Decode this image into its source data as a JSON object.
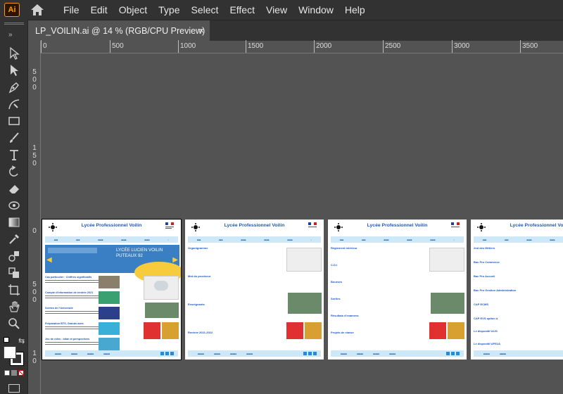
{
  "app": {
    "logo": "Ai",
    "home_icon": "home-icon"
  },
  "menu": [
    "File",
    "Edit",
    "Object",
    "Type",
    "Select",
    "Effect",
    "View",
    "Window",
    "Help"
  ],
  "document_tab": {
    "title": "LP_VOILIN.ai @ 14 % (RGB/CPU Preview)",
    "close": "×"
  },
  "ruler": {
    "top": [
      "0",
      "500",
      "1000",
      "1500",
      "2000",
      "2500",
      "3000",
      "3500"
    ],
    "left": [
      "5",
      "0",
      "0",
      "1",
      "5",
      "0",
      "0",
      "5",
      "0",
      "0",
      "1",
      "0"
    ]
  },
  "artboards": {
    "title": "Lycée Professionnel Voilin",
    "home": {
      "banner": "LYCÉE LUCIEN VOILIN PUTEAUX 92",
      "news": [
        "Cas particulier : Chiffres significatifs",
        "Compte d'information de rentrée 2021",
        "Sorties de l'Université",
        "Préparation BTS, Grands axes",
        "Jeu de rôles : bilan et perspectives"
      ]
    },
    "page2": {
      "links": [
        "Organigramme",
        "Mot du proviseur",
        "Enseignants",
        "Rentrée 2021-2022"
      ]
    },
    "page3": {
      "links": [
        "Règlement intérieur",
        "C.D.I",
        "Bourses",
        "Sorties",
        "Résultats d'examens",
        "Projets de classe"
      ]
    },
    "page4": {
      "links": [
        "2nd des Métiers",
        "Bac Pro Commerce",
        "Bac Pro Accueil",
        "Bac Pro Gestion Administration",
        "CAP ECMS",
        "CAP EVS option A",
        "Le dispositif ULIS",
        "Le dispositif UPE2A"
      ]
    }
  },
  "colors": {
    "brand": "#1e56c8",
    "chrome": "#323232",
    "canvas": "#535353"
  }
}
